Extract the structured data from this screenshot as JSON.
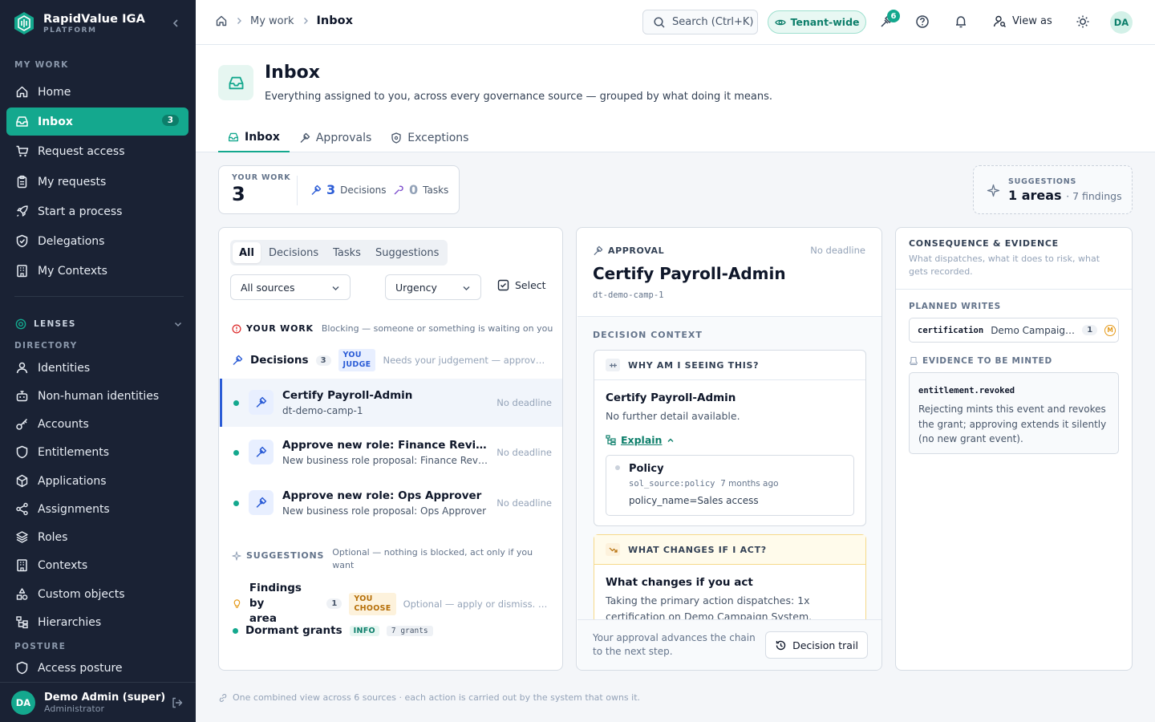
{
  "brand": {
    "name": "RapidValue IGA",
    "sub": "PLATFORM"
  },
  "sidebar": {
    "section_mywork": "MY WORK",
    "mywork_items": [
      {
        "label": "Home",
        "icon": "home-icon"
      },
      {
        "label": "Inbox",
        "icon": "inbox-icon",
        "badge": "3",
        "active": true
      },
      {
        "label": "Request access",
        "icon": "cart-icon"
      },
      {
        "label": "My requests",
        "icon": "clipboard-icon"
      },
      {
        "label": "Start a process",
        "icon": "rocket-icon"
      },
      {
        "label": "Delegations",
        "icon": "shield-check-icon"
      },
      {
        "label": "My Contexts",
        "icon": "building-icon"
      }
    ],
    "lenses_label": "LENSES",
    "section_directory": "DIRECTORY",
    "directory_items": [
      {
        "label": "Identities",
        "icon": "user-icon"
      },
      {
        "label": "Non-human identities",
        "icon": "bot-icon"
      },
      {
        "label": "Accounts",
        "icon": "key-icon"
      },
      {
        "label": "Entitlements",
        "icon": "shield-icon"
      },
      {
        "label": "Applications",
        "icon": "cube-icon"
      },
      {
        "label": "Assignments",
        "icon": "share-icon"
      },
      {
        "label": "Roles",
        "icon": "layers-icon"
      },
      {
        "label": "Contexts",
        "icon": "building-icon"
      },
      {
        "label": "Custom objects",
        "icon": "shapes-icon"
      },
      {
        "label": "Hierarchies",
        "icon": "hierarchy-icon"
      }
    ],
    "section_posture": "POSTURE",
    "posture_items": [
      {
        "label": "Access posture",
        "icon": "posture-icon"
      }
    ],
    "user": {
      "initials": "DA",
      "name": "Demo Admin (super)",
      "role": "Administrator"
    }
  },
  "topbar": {
    "breadcrumbs": [
      "My work",
      "Inbox"
    ],
    "search_label": "Search (Ctrl+K)",
    "tenant_label": "Tenant-wide",
    "tasks_badge": "6",
    "view_as": "View as",
    "avatar_initials": "DA"
  },
  "header": {
    "title": "Inbox",
    "subtitle": "Everything assigned to you, across every governance source — grouped by what doing it means.",
    "tabs": [
      {
        "label": "Inbox",
        "active": true
      },
      {
        "label": "Approvals"
      },
      {
        "label": "Exceptions"
      }
    ]
  },
  "summary": {
    "label": "YOUR WORK",
    "total": "3",
    "decisions_count": "3",
    "decisions_label": "Decisions",
    "tasks_count": "0",
    "tasks_label": "Tasks",
    "suggestions_label": "SUGGESTIONS",
    "suggestions_value": "1 areas",
    "suggestions_extra": "· 7 findings"
  },
  "list": {
    "filters": [
      "All",
      "Decisions",
      "Tasks",
      "Suggestions"
    ],
    "source_select": "All sources",
    "urgency_select": "Urgency",
    "select_label": "Select",
    "yourwork_title": "YOUR WORK",
    "yourwork_desc": "Blocking — someone or something is waiting on you",
    "decisions_group": {
      "title": "Decisions",
      "count": "3",
      "tag_line1": "YOU",
      "tag_line2": "JUDGE",
      "desc": "Needs your judgement — approve, reject or escalate"
    },
    "items": [
      {
        "title": "Certify Payroll-Admin",
        "sub": "dt-demo-camp-1",
        "deadline": "No deadline"
      },
      {
        "title": "Approve new role: Finance Reviewer",
        "sub": "New business role proposal: Finance Reviewer",
        "deadline": "No deadline"
      },
      {
        "title": "Approve new role: Ops Approver",
        "sub": "New business role proposal: Ops Approver",
        "deadline": "No deadline"
      }
    ],
    "suggestions_title": "SUGGESTIONS",
    "suggestions_desc_1": "Optional — nothing is blocked, act only if you",
    "suggestions_desc_2": "want",
    "findings_group": {
      "title_1": "Findings by",
      "title_2": "area",
      "count": "1",
      "tag_line1": "YOU",
      "tag_line2": "CHOOSE",
      "desc": "Optional — apply or dismiss. Nothing waits on it"
    },
    "dormant": {
      "title": "Dormant grants",
      "tag": "INFO",
      "count": "7 grants"
    }
  },
  "detail": {
    "kind": "APPROVAL",
    "deadline": "No deadline",
    "title": "Certify Payroll-Admin",
    "id": "dt-demo-camp-1",
    "context_label": "DECISION CONTEXT",
    "why_head": "WHY AM I SEEING THIS?",
    "why_title": "Certify Payroll-Admin",
    "why_desc": "No further detail available.",
    "explain": "Explain",
    "policy": {
      "title": "Policy",
      "source": "sol_source:policy",
      "age": "7 months ago",
      "value": "policy_name=Sales access"
    },
    "change_head": "WHAT CHANGES IF I ACT?",
    "change_title": "What changes if you act",
    "change_desc": "Taking the primary action dispatches: 1x certification on Demo Campaign System.",
    "footer_note": "Your approval advances the chain to the next step.",
    "trail_button": "Decision trail"
  },
  "conseq": {
    "title": "CONSEQUENCE & EVIDENCE",
    "subtitle": "What dispatches, what it does to risk, what gets recorded.",
    "planned_label": "PLANNED WRITES",
    "planned_kind": "certification",
    "planned_target": "Demo Campaign System",
    "planned_count": "1",
    "planned_marker": "M",
    "evidence_label": "EVIDENCE TO BE MINTED",
    "evidence_event": "entitlement.revoked",
    "evidence_desc": "Rejecting mints this event and revokes the grant; approving extends it silently (no new grant event)."
  },
  "footnote": "One combined view across 6 sources · each action is carried out by the system that owns it."
}
